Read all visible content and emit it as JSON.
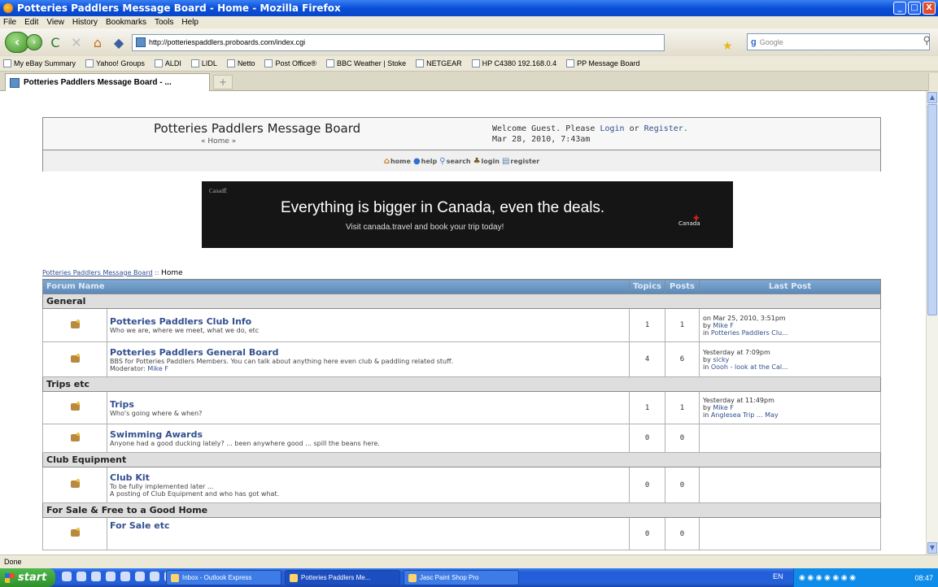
{
  "window": {
    "title": "Potteries Paddlers Message Board - Home - Mozilla Firefox",
    "minimize": "_",
    "maximize": "□",
    "close": "X"
  },
  "menu": [
    "File",
    "Edit",
    "View",
    "History",
    "Bookmarks",
    "Tools",
    "Help"
  ],
  "nav": {
    "url": "http://potteriespaddlers.proboards.com/index.cgi",
    "search_placeholder": "Google"
  },
  "bookmarks": [
    "My eBay Summary",
    "Yahoo! Groups",
    "ALDI",
    "LIDL",
    "Netto",
    "Post Office®",
    "BBC Weather | Stoke",
    "NETGEAR",
    "HP C4380 192.168.0.4",
    "PP Message Board"
  ],
  "tab": {
    "label": "Potteries Paddlers Message Board - ..."
  },
  "header": {
    "title": "Potteries Paddlers Message Board",
    "subtitle": "« Home »",
    "welcome_prefix": "Welcome Guest. Please ",
    "login": "Login",
    "or": " or ",
    "register": "Register.",
    "datetime": "Mar 28, 2010, 7:43am"
  },
  "board_nav": [
    {
      "label": "home",
      "icon": "home-icon"
    },
    {
      "label": "help",
      "icon": "help-icon"
    },
    {
      "label": "search",
      "icon": "search-icon"
    },
    {
      "label": "login",
      "icon": "login-icon"
    },
    {
      "label": "register",
      "icon": "register-icon"
    }
  ],
  "ad": {
    "brand": "CanadË",
    "headline": "Everything is bigger in Canada, even the deals.",
    "subline": "Visit canada.travel and book your trip today!",
    "logo": "Canada"
  },
  "breadcrumb": {
    "link": "Potteries Paddlers Message Board",
    "sep": " :: ",
    "current": "Home"
  },
  "table": {
    "headers": {
      "forum": "Forum Name",
      "topics": "Topics",
      "posts": "Posts",
      "last": "Last Post"
    },
    "categories": [
      {
        "name": "General",
        "boards": [
          {
            "name": "Potteries Paddlers Club Info",
            "desc": "Who we are, where we meet, what we do, etc",
            "moderator_label": "",
            "moderator": "",
            "topics": "1",
            "posts": "1",
            "last_line1": "on Mar 25, 2010, 3:51pm",
            "last_line2": "by ",
            "last_by": "Mike F",
            "last_line3": "in ",
            "last_in": "Potteries Paddlers Clu..."
          },
          {
            "name": "Potteries Paddlers General Board",
            "desc": "BBS for Potteries Paddlers Members. You can talk about anything here even club & paddling related stuff.",
            "moderator_label": "Moderator: ",
            "moderator": "Mike F",
            "topics": "4",
            "posts": "6",
            "last_line1": "Yesterday at 7:09pm",
            "last_line2": "by ",
            "last_by": "sicky",
            "last_line3": "in ",
            "last_in": "Oooh - look at the Cal..."
          }
        ]
      },
      {
        "name": "Trips etc",
        "boards": [
          {
            "name": "Trips",
            "desc": "Who's going where & when?",
            "moderator_label": "",
            "moderator": "",
            "topics": "1",
            "posts": "1",
            "last_line1": "Yesterday at 11:49pm",
            "last_line2": "by ",
            "last_by": "Mike F",
            "last_line3": "in ",
            "last_in": "Anglesea Trip ... May"
          },
          {
            "name": "Swimming Awards",
            "desc": "Anyone had a good ducking lately? ... been anywhere good ... spill the beans here.",
            "moderator_label": "",
            "moderator": "",
            "topics": "0",
            "posts": "0",
            "last_line1": "",
            "last_line2": "",
            "last_by": "",
            "last_line3": "",
            "last_in": ""
          }
        ]
      },
      {
        "name": "Club Equipment",
        "boards": [
          {
            "name": "Club Kit",
            "desc": "To be fully implemented later ...",
            "desc2": "A posting of Club Equipment and who has got what.",
            "moderator_label": "",
            "moderator": "",
            "topics": "0",
            "posts": "0",
            "last_line1": "",
            "last_line2": "",
            "last_by": "",
            "last_line3": "",
            "last_in": ""
          }
        ]
      },
      {
        "name": "For Sale & Free to a Good Home",
        "boards": [
          {
            "name": "For Sale etc",
            "desc": "",
            "moderator_label": "",
            "moderator": "",
            "topics": "0",
            "posts": "0",
            "last_line1": "",
            "last_line2": "",
            "last_by": "",
            "last_line3": "",
            "last_in": ""
          }
        ]
      }
    ]
  },
  "status": "Done",
  "taskbar": {
    "start": "start",
    "buttons": [
      "Inbox - Outlook Express",
      "Potteries Paddlers Me...",
      "Jasc Paint Shop Pro"
    ],
    "lang": "EN",
    "clock": "08:47"
  }
}
